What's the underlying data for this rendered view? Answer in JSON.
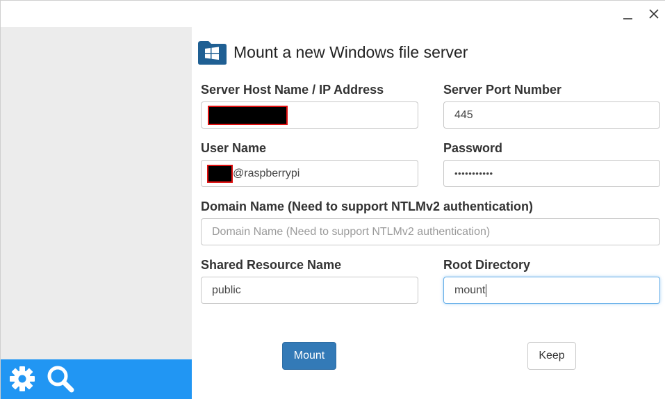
{
  "window": {
    "minimize_icon": "minimize-icon",
    "close_icon": "close-icon"
  },
  "sidebar": {
    "tools": [
      {
        "icon": "gear-icon"
      },
      {
        "icon": "search-icon"
      }
    ],
    "accent_color": "#2196f3"
  },
  "form": {
    "title": "Mount a new Windows file server",
    "title_icon": "windows-folder-icon",
    "server_host": {
      "label": "Server Host Name / IP Address",
      "value": ""
    },
    "server_port": {
      "label": "Server Port Number",
      "value": "445"
    },
    "user_name": {
      "label": "User Name",
      "value_suffix": "@raspberrypi"
    },
    "password": {
      "label": "Password",
      "value": "•••••••••••"
    },
    "domain_name": {
      "label": "Domain Name (Need to support NTLMv2 authentication)",
      "placeholder": "Domain Name (Need to support NTLMv2 authentication)",
      "value": ""
    },
    "shared_resource": {
      "label": "Shared Resource Name",
      "value": "public"
    },
    "root_directory": {
      "label": "Root Directory",
      "value": "mount"
    },
    "mount_button": "Mount",
    "keep_button": "Keep",
    "primary_color": "#337ab7"
  }
}
